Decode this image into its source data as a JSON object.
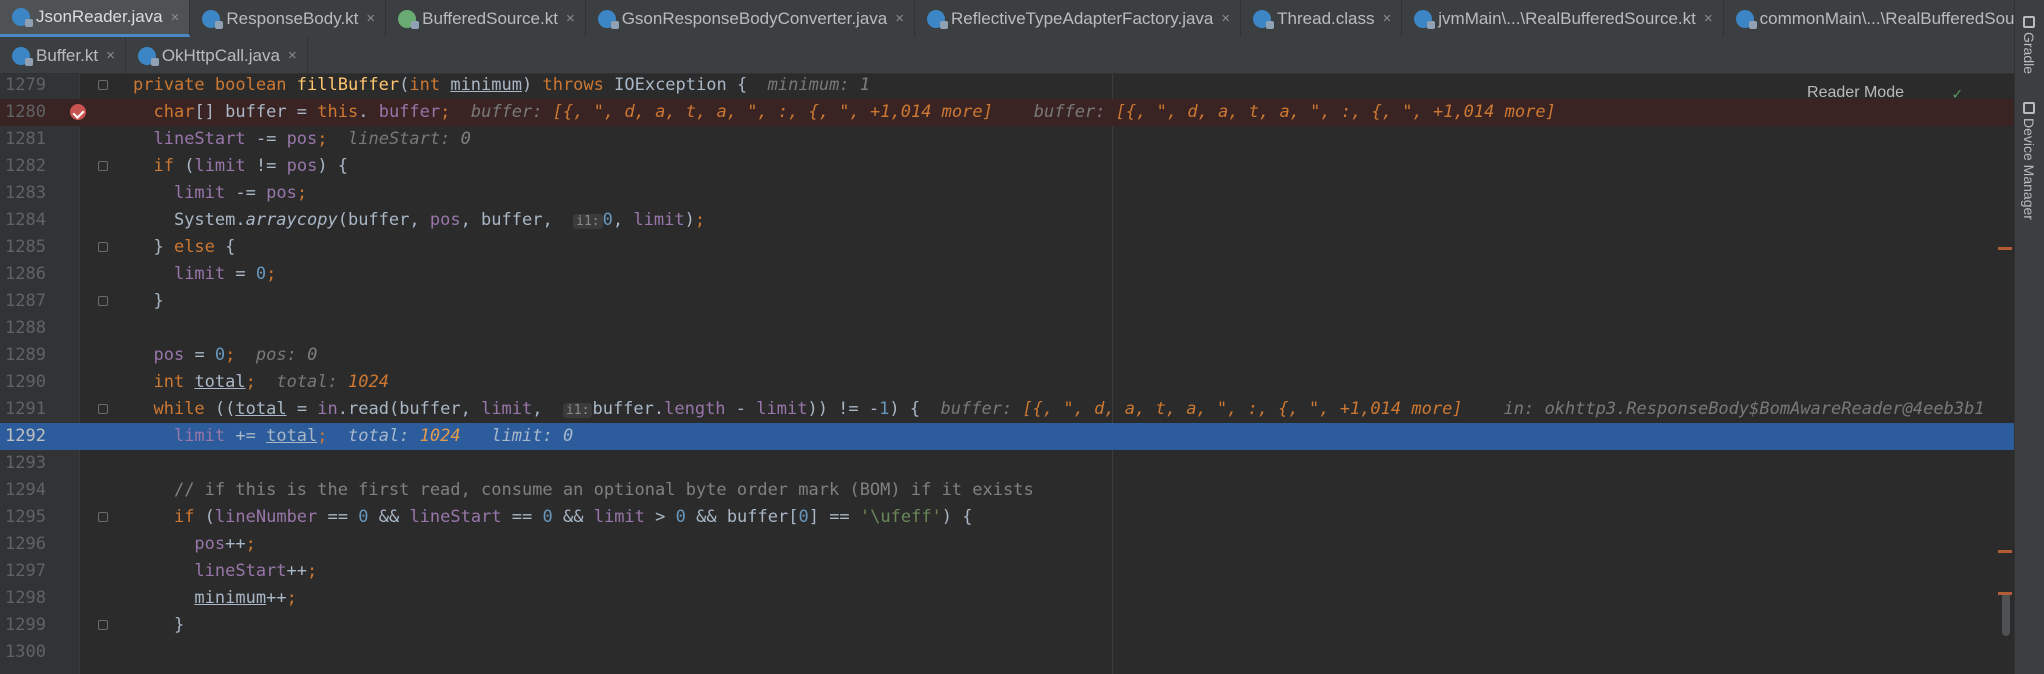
{
  "tabs_row1": [
    {
      "label": "JsonReader.java",
      "type": "java",
      "active": true
    },
    {
      "label": "ResponseBody.kt",
      "type": "java"
    },
    {
      "label": "BufferedSource.kt",
      "type": "kt"
    },
    {
      "label": "GsonResponseBodyConverter.java",
      "type": "java"
    },
    {
      "label": "ReflectiveTypeAdapterFactory.java",
      "type": "java"
    },
    {
      "label": "Thread.class",
      "type": "cls"
    },
    {
      "label": "jvmMain\\...\\RealBufferedSource.kt",
      "type": "java"
    },
    {
      "label": "commonMain\\...\\RealBufferedSource.kt",
      "type": "java"
    }
  ],
  "tabs_row2": [
    {
      "label": "Buffer.kt",
      "type": "java"
    },
    {
      "label": "OkHttpCall.java",
      "type": "java"
    }
  ],
  "close_glyph": "×",
  "tool_windows": [
    "Gradle",
    "Device Manager"
  ],
  "reader_mode_label": "Reader Mode",
  "check_glyph": "✓",
  "lines": [
    {
      "n": "1279",
      "fold": true,
      "tokens": [
        [
          "kw",
          "private boolean "
        ],
        [
          "fn",
          "fillBuffer"
        ],
        [
          "",
          "("
        ],
        [
          "kw",
          "int "
        ],
        [
          "ul",
          "minimum"
        ],
        [
          "",
          ") "
        ],
        [
          "kw",
          "throws "
        ],
        [
          "",
          "IOException {  "
        ],
        [
          "hint",
          "minimum: "
        ],
        [
          "hintn",
          "1"
        ]
      ]
    },
    {
      "n": "1280",
      "bp": true,
      "tokens": [
        [
          "",
          "  "
        ],
        [
          "kw",
          "char"
        ],
        [
          "",
          "[] buffer = "
        ],
        [
          "kw",
          "this"
        ],
        [
          "",
          ". "
        ],
        [
          "fld",
          "buffer"
        ],
        [
          "kw",
          ";  "
        ],
        [
          "hint",
          "buffer: "
        ],
        [
          "hintv",
          "[{, \", d, a, t, a, \", :, {, \", +1,014 more]"
        ],
        [
          "",
          "    "
        ],
        [
          "hint",
          "buffer: "
        ],
        [
          "hintv",
          "[{, \", d, a, t, a, \", :, {, \", +1,014 more]"
        ]
      ]
    },
    {
      "n": "1281",
      "tokens": [
        [
          "",
          "  "
        ],
        [
          "fld",
          "lineStart"
        ],
        [
          "",
          " -= "
        ],
        [
          "fld",
          "pos"
        ],
        [
          "kw",
          ";  "
        ],
        [
          "hint",
          "lineStart: "
        ],
        [
          "hintn",
          "0"
        ]
      ]
    },
    {
      "n": "1282",
      "fold": true,
      "tokens": [
        [
          "",
          "  "
        ],
        [
          "kw",
          "if "
        ],
        [
          "",
          "("
        ],
        [
          "fld",
          "limit"
        ],
        [
          "",
          " != "
        ],
        [
          "fld",
          "pos"
        ],
        [
          "",
          ") {"
        ]
      ]
    },
    {
      "n": "1283",
      "tokens": [
        [
          "",
          "    "
        ],
        [
          "fld",
          "limit"
        ],
        [
          "",
          " -= "
        ],
        [
          "fld",
          "pos"
        ],
        [
          "kw",
          ";"
        ]
      ]
    },
    {
      "n": "1284",
      "tokens": [
        [
          "",
          "    System."
        ],
        [
          "it",
          "arraycopy"
        ],
        [
          "",
          "(buffer, "
        ],
        [
          "fld",
          "pos"
        ],
        [
          "",
          ", buffer,  "
        ],
        [
          "inlay",
          "i1:"
        ],
        [
          "num",
          "0"
        ],
        [
          "",
          ", "
        ],
        [
          "fld",
          "limit"
        ],
        [
          "",
          ")"
        ],
        [
          "kw",
          ";"
        ]
      ]
    },
    {
      "n": "1285",
      "fold": true,
      "tokens": [
        [
          "",
          "  } "
        ],
        [
          "kw",
          "else "
        ],
        [
          "",
          "{"
        ]
      ]
    },
    {
      "n": "1286",
      "tokens": [
        [
          "",
          "    "
        ],
        [
          "fld",
          "limit"
        ],
        [
          "",
          " = "
        ],
        [
          "num",
          "0"
        ],
        [
          "kw",
          ";"
        ]
      ]
    },
    {
      "n": "1287",
      "fold": true,
      "tokens": [
        [
          "",
          "  }"
        ]
      ]
    },
    {
      "n": "1288",
      "tokens": []
    },
    {
      "n": "1289",
      "tokens": [
        [
          "",
          "  "
        ],
        [
          "fld",
          "pos"
        ],
        [
          "",
          " = "
        ],
        [
          "num",
          "0"
        ],
        [
          "kw",
          ";  "
        ],
        [
          "hint",
          "pos: "
        ],
        [
          "hintn",
          "0"
        ]
      ]
    },
    {
      "n": "1290",
      "tokens": [
        [
          "",
          "  "
        ],
        [
          "kw",
          "int "
        ],
        [
          "ul",
          "total"
        ],
        [
          "kw",
          ";  "
        ],
        [
          "hint",
          "total: "
        ],
        [
          "hintv",
          "1024"
        ]
      ]
    },
    {
      "n": "1291",
      "fold": true,
      "tokens": [
        [
          "",
          "  "
        ],
        [
          "kw",
          "while "
        ],
        [
          "",
          "(("
        ],
        [
          "ul",
          "total"
        ],
        [
          "",
          " = "
        ],
        [
          "fld",
          "in"
        ],
        [
          "",
          ".read(buffer, "
        ],
        [
          "fld",
          "limit"
        ],
        [
          "",
          ",  "
        ],
        [
          "inlay",
          "i1:"
        ],
        [
          "",
          "buffer."
        ],
        [
          "fld",
          "length"
        ],
        [
          "",
          " - "
        ],
        [
          "fld",
          "limit"
        ],
        [
          "",
          ")) != -"
        ],
        [
          "num",
          "1"
        ],
        [
          "",
          ") {  "
        ],
        [
          "hint",
          "buffer: "
        ],
        [
          "hintv",
          "[{, \", d, a, t, a, \", :, {, \", +1,014 more]"
        ],
        [
          "",
          "    "
        ],
        [
          "hint",
          "in: okhttp3.ResponseBody$BomAwareReader@4eeb3b1"
        ]
      ]
    },
    {
      "n": "1292",
      "exec": true,
      "tokens": [
        [
          "",
          "    "
        ],
        [
          "fld",
          "limit"
        ],
        [
          "",
          " += "
        ],
        [
          "ul",
          "total"
        ],
        [
          "kw",
          ";  "
        ],
        [
          "hint",
          "total: "
        ],
        [
          "hintv",
          "1024"
        ],
        [
          "",
          "   "
        ],
        [
          "hint",
          "limit: "
        ],
        [
          "hintn",
          "0"
        ]
      ]
    },
    {
      "n": "1293",
      "tokens": []
    },
    {
      "n": "1294",
      "tokens": [
        [
          "",
          "    "
        ],
        [
          "cmt",
          "// if this is the first read, consume an optional byte order mark (BOM) if it exists"
        ]
      ]
    },
    {
      "n": "1295",
      "fold": true,
      "tokens": [
        [
          "",
          "    "
        ],
        [
          "kw",
          "if "
        ],
        [
          "",
          "("
        ],
        [
          "fld",
          "lineNumber"
        ],
        [
          "",
          " == "
        ],
        [
          "num",
          "0"
        ],
        [
          "",
          " && "
        ],
        [
          "fld",
          "lineStart"
        ],
        [
          "",
          " == "
        ],
        [
          "num",
          "0"
        ],
        [
          "",
          " && "
        ],
        [
          "fld",
          "limit"
        ],
        [
          "",
          " > "
        ],
        [
          "num",
          "0"
        ],
        [
          "",
          " && buffer["
        ],
        [
          "num",
          "0"
        ],
        [
          "",
          "] == "
        ],
        [
          "str",
          "'\\ufeff'"
        ],
        [
          "",
          ") {"
        ]
      ]
    },
    {
      "n": "1296",
      "tokens": [
        [
          "",
          "      "
        ],
        [
          "fld",
          "pos"
        ],
        [
          "",
          "++"
        ],
        [
          "kw",
          ";"
        ]
      ]
    },
    {
      "n": "1297",
      "tokens": [
        [
          "",
          "      "
        ],
        [
          "fld",
          "lineStart"
        ],
        [
          "",
          "++"
        ],
        [
          "kw",
          ";"
        ]
      ]
    },
    {
      "n": "1298",
      "tokens": [
        [
          "",
          "      "
        ],
        [
          "ul",
          "minimum"
        ],
        [
          "",
          "++"
        ],
        [
          "kw",
          ";"
        ]
      ]
    },
    {
      "n": "1299",
      "fold": true,
      "tokens": [
        [
          "",
          "    }"
        ]
      ]
    },
    {
      "n": "1300",
      "tokens": []
    }
  ]
}
